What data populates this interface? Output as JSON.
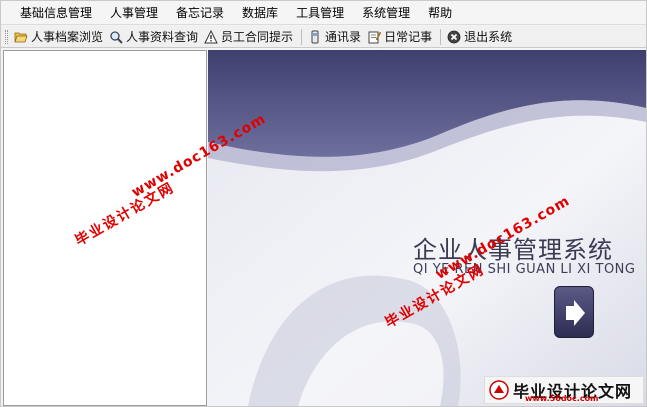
{
  "menu": {
    "items": [
      {
        "label": "基础信息管理"
      },
      {
        "label": "人事管理"
      },
      {
        "label": "备忘记录"
      },
      {
        "label": "数据库"
      },
      {
        "label": "工具管理"
      },
      {
        "label": "系统管理"
      },
      {
        "label": "帮助"
      }
    ]
  },
  "toolbar": {
    "items": [
      {
        "label": "人事档案浏览",
        "icon": "folder-open-icon"
      },
      {
        "label": "人事资料查询",
        "icon": "magnifier-icon"
      },
      {
        "label": "员工合同提示",
        "icon": "warning-icon"
      },
      {
        "label": "通讯录",
        "icon": "phone-icon"
      },
      {
        "label": "日常记事",
        "icon": "notepad-icon"
      },
      {
        "label": "退出系统",
        "icon": "exit-icon"
      }
    ]
  },
  "splash": {
    "title": "企业人事管理系统",
    "pinyin": "QI YE REN SHI GUAN LI XI TONG"
  },
  "watermarks": {
    "site_text": "毕业设计论文网",
    "url_text": "www.doc163.com"
  },
  "badge": {
    "text": "毕业设计论文网",
    "url": "www.56doc.com"
  },
  "colors": {
    "wave_dark": "#4a4a7a",
    "wave_light": "#eef0f6",
    "watermark": "#e00000"
  }
}
